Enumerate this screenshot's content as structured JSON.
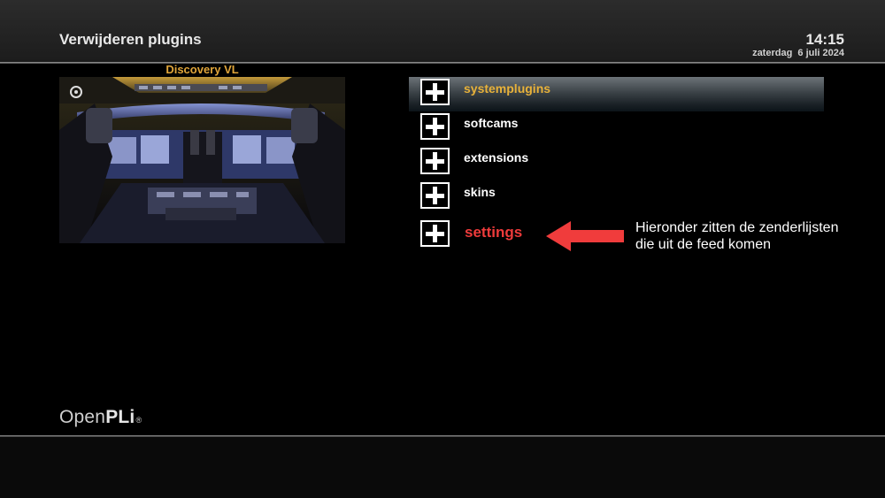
{
  "header": {
    "title": "Verwijderen plugins",
    "time": "14:15",
    "date": "zaterdag  6 juli 2024"
  },
  "preview": {
    "channel": "Discovery VL"
  },
  "menu": {
    "items": [
      {
        "label": "systemplugins",
        "state": "selected"
      },
      {
        "label": "softcams",
        "state": "normal"
      },
      {
        "label": "extensions",
        "state": "normal"
      },
      {
        "label": "skins",
        "state": "normal"
      },
      {
        "label": "settings",
        "state": "highlight"
      }
    ]
  },
  "annotation": {
    "line1": "Hieronder zitten de zenderlijsten",
    "line2": "die uit de feed komen"
  },
  "logo": {
    "open": "Open",
    "pli": "PLi",
    "reg": "®"
  },
  "colors": {
    "accent": "#e8b23a",
    "highlight": "#ee3b3b",
    "arrow": "#f03c3c"
  }
}
